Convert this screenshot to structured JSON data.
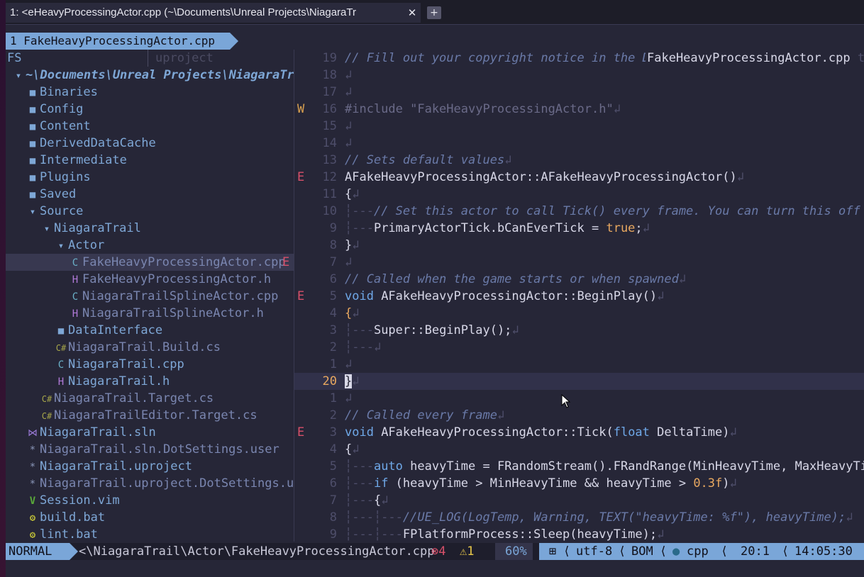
{
  "window": {
    "tab_title": "1: <eHeavyProcessingActor.cpp (~\\Documents\\Unreal Projects\\NiagaraTr",
    "close_glyph": "✕",
    "add_glyph": "+"
  },
  "buffer_tab": {
    "label": "1 FakeHeavyProcessingActor.cpp"
  },
  "tree": {
    "header": "FS",
    "hint": "uproject",
    "error_marker": "E",
    "rows": [
      {
        "icon": "▾",
        "label": "~\\Documents\\Unreal Projects\\NiagaraTr"
      },
      {
        "icon": "■",
        "label": "Binaries"
      },
      {
        "icon": "■",
        "label": "Config"
      },
      {
        "icon": "■",
        "label": "Content"
      },
      {
        "icon": "■",
        "label": "DerivedDataCache"
      },
      {
        "icon": "■",
        "label": "Intermediate"
      },
      {
        "icon": "■",
        "label": "Plugins"
      },
      {
        "icon": "■",
        "label": "Saved"
      },
      {
        "icon": "▾",
        "label": "Source"
      },
      {
        "icon": "▾",
        "label": "NiagaraTrail"
      },
      {
        "icon": "▾",
        "label": "Actor"
      },
      {
        "icon": "C",
        "label": "FakeHeavyProcessingActor.cpp"
      },
      {
        "icon": "H",
        "label": "FakeHeavyProcessingActor.h"
      },
      {
        "icon": "C",
        "label": "NiagaraTrailSplineActor.cpp"
      },
      {
        "icon": "H",
        "label": "NiagaraTrailSplineActor.h"
      },
      {
        "icon": "■",
        "label": "DataInterface"
      },
      {
        "icon": "C#",
        "label": "NiagaraTrail.Build.cs"
      },
      {
        "icon": "C",
        "label": "NiagaraTrail.cpp"
      },
      {
        "icon": "H",
        "label": "NiagaraTrail.h"
      },
      {
        "icon": "C#",
        "label": "NiagaraTrail.Target.cs"
      },
      {
        "icon": "C#",
        "label": "NiagaraTrailEditor.Target.cs"
      },
      {
        "icon": "⋈",
        "label": "NiagaraTrail.sln"
      },
      {
        "icon": "*",
        "label": "NiagaraTrail.sln.DotSettings.user"
      },
      {
        "icon": "*",
        "label": "NiagaraTrail.uproject"
      },
      {
        "icon": "*",
        "label": "NiagaraTrail.uproject.DotSettings.u"
      },
      {
        "icon": "V",
        "label": "Session.vim"
      },
      {
        "icon": "⚙",
        "label": "build.bat"
      },
      {
        "icon": "⚙",
        "label": "lint.bat"
      }
    ]
  },
  "editor": {
    "file_label": "FakeHeavyProcessingActor.cpp",
    "file_label_tail": "t",
    "eol": "↲",
    "lines": [
      {
        "n": "19",
        "sign": "",
        "text": "// Fill out your copyright notice in the D"
      },
      {
        "n": "18",
        "sign": "",
        "text": ""
      },
      {
        "n": "17",
        "sign": "",
        "text": ""
      },
      {
        "n": "16",
        "sign": "W",
        "text": "#include \"FakeHeavyProcessingActor.h\""
      },
      {
        "n": "15",
        "sign": "",
        "text": ""
      },
      {
        "n": "14",
        "sign": "",
        "text": ""
      },
      {
        "n": "13",
        "sign": "",
        "text": "// Sets default values"
      },
      {
        "n": "12",
        "sign": "E",
        "text": "AFakeHeavyProcessingActor::AFakeHeavyProcessingActor()"
      },
      {
        "n": "11",
        "sign": "",
        "text": "{"
      },
      {
        "n": "10",
        "sign": "",
        "text": "// Set this actor to call Tick() every frame.  You can turn this off"
      },
      {
        "n": "9",
        "sign": "",
        "text": "PrimaryActorTick.bCanEverTick = ",
        "kw_tail": "true",
        "tail": ";"
      },
      {
        "n": "8",
        "sign": "",
        "text": "}"
      },
      {
        "n": "7",
        "sign": "",
        "text": ""
      },
      {
        "n": "6",
        "sign": "",
        "text": "// Called when the game starts or when spawned"
      },
      {
        "n": "5",
        "sign": "E",
        "kw": "void",
        "text": " AFakeHeavyProcessingActor::BeginPlay()"
      },
      {
        "n": "4",
        "sign": "",
        "text": "{"
      },
      {
        "n": "3",
        "sign": "",
        "text": "Super::BeginPlay();"
      },
      {
        "n": "2",
        "sign": "",
        "text": ""
      },
      {
        "n": "1",
        "sign": "",
        "text": ""
      },
      {
        "n": "20",
        "sign": "",
        "text": "}"
      },
      {
        "n": "1",
        "sign": "",
        "text": ""
      },
      {
        "n": "2",
        "sign": "",
        "text": "// Called every frame"
      },
      {
        "n": "3",
        "sign": "E",
        "kw": "void",
        "text": " AFakeHeavyProcessingActor::Tick(",
        "kw2": "float",
        "tail": " DeltaTime)"
      },
      {
        "n": "4",
        "sign": "",
        "text": "{"
      },
      {
        "n": "5",
        "sign": "",
        "kw": "auto",
        "text": " heavyTime = FRandomStream().FRandRange(MinHeavyTime, MaxHeavyTim"
      },
      {
        "n": "6",
        "sign": "",
        "kw": "if",
        "text": " (heavyTime > MinHeavyTime && heavyTime > ",
        "num": "0.3f",
        "tail": ")"
      },
      {
        "n": "7",
        "sign": "",
        "text": "{"
      },
      {
        "n": "8",
        "sign": "",
        "text": "//UE_LOG(LogTemp, Warning, TEXT(\"heavyTime: %f\"), heavyTime);"
      },
      {
        "n": "9",
        "sign": "",
        "text": "FPlatformProcess::Sleep(heavyTime);"
      }
    ]
  },
  "statusbar": {
    "mode": "NORMAL",
    "path": "<\\NiagaraTrail\\Actor\\FakeHeavyProcessingActor.cpp",
    "errors": "⊗4",
    "warnings": "⚠1",
    "percent": "60%",
    "os_icon": "⊞",
    "encoding": "utf-8",
    "bom": "BOM",
    "filetype": "cpp",
    "position": "20:1",
    "time": "14:05:30",
    "sep": "⟨"
  }
}
